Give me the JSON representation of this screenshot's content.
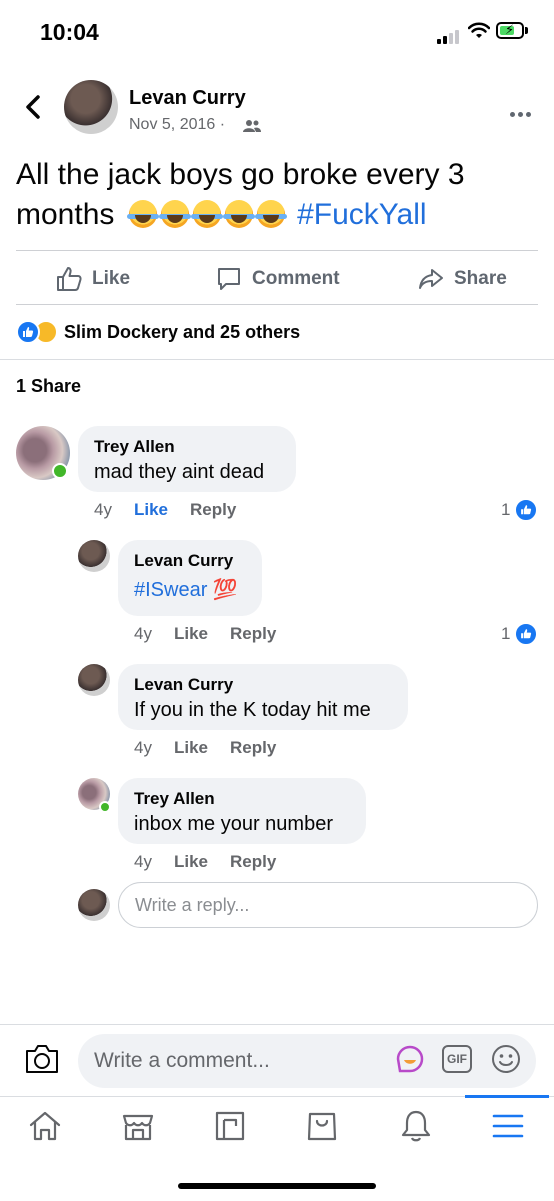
{
  "status_bar": {
    "time": "10:04"
  },
  "post": {
    "author": "Levan Curry",
    "date": "Nov 5, 2016 ·",
    "text_line1": "All the jack boys go broke every 3",
    "text_line2_prefix": "months",
    "hashtag": "#FuckYall",
    "emoji_count": 5
  },
  "actions": {
    "like": "Like",
    "comment": "Comment",
    "share": "Share"
  },
  "reactions": {
    "summary": "Slim Dockery and 25 others"
  },
  "shares": {
    "label": "1 Share"
  },
  "comments": [
    {
      "name": "Trey Allen",
      "text": "mad they aint dead",
      "age": "4y",
      "like": "Like",
      "reply": "Reply",
      "likes": "1",
      "liked": true
    },
    {
      "name": "Levan Curry",
      "text": "#ISwear 💯",
      "age": "4y",
      "like": "Like",
      "reply": "Reply",
      "likes": "1",
      "liked": false
    },
    {
      "name": "Levan Curry",
      "text": "If you in the K today hit me",
      "age": "4y",
      "like": "Like",
      "reply": "Reply"
    },
    {
      "name": "Trey Allen",
      "text": "inbox me your number",
      "age": "4y",
      "like": "Like",
      "reply": "Reply"
    }
  ],
  "reply_input": {
    "placeholder": "Write a reply..."
  },
  "comment_input": {
    "placeholder": "Write a comment..."
  },
  "gif_label": "GIF",
  "colors": {
    "link_blue": "#216fdb",
    "fb_blue": "#1877f2",
    "bubble_bg": "#f0f2f5",
    "online_green": "#42b72a"
  },
  "icons": [
    "back-arrow-icon",
    "friends-icon",
    "more-icon",
    "like-icon",
    "comment-icon",
    "share-icon",
    "camera-icon",
    "sticker-icon",
    "gif-icon",
    "emoji-icon",
    "home-icon",
    "marketplace-icon",
    "pages-icon",
    "shop-icon",
    "notifications-icon",
    "menu-icon"
  ]
}
